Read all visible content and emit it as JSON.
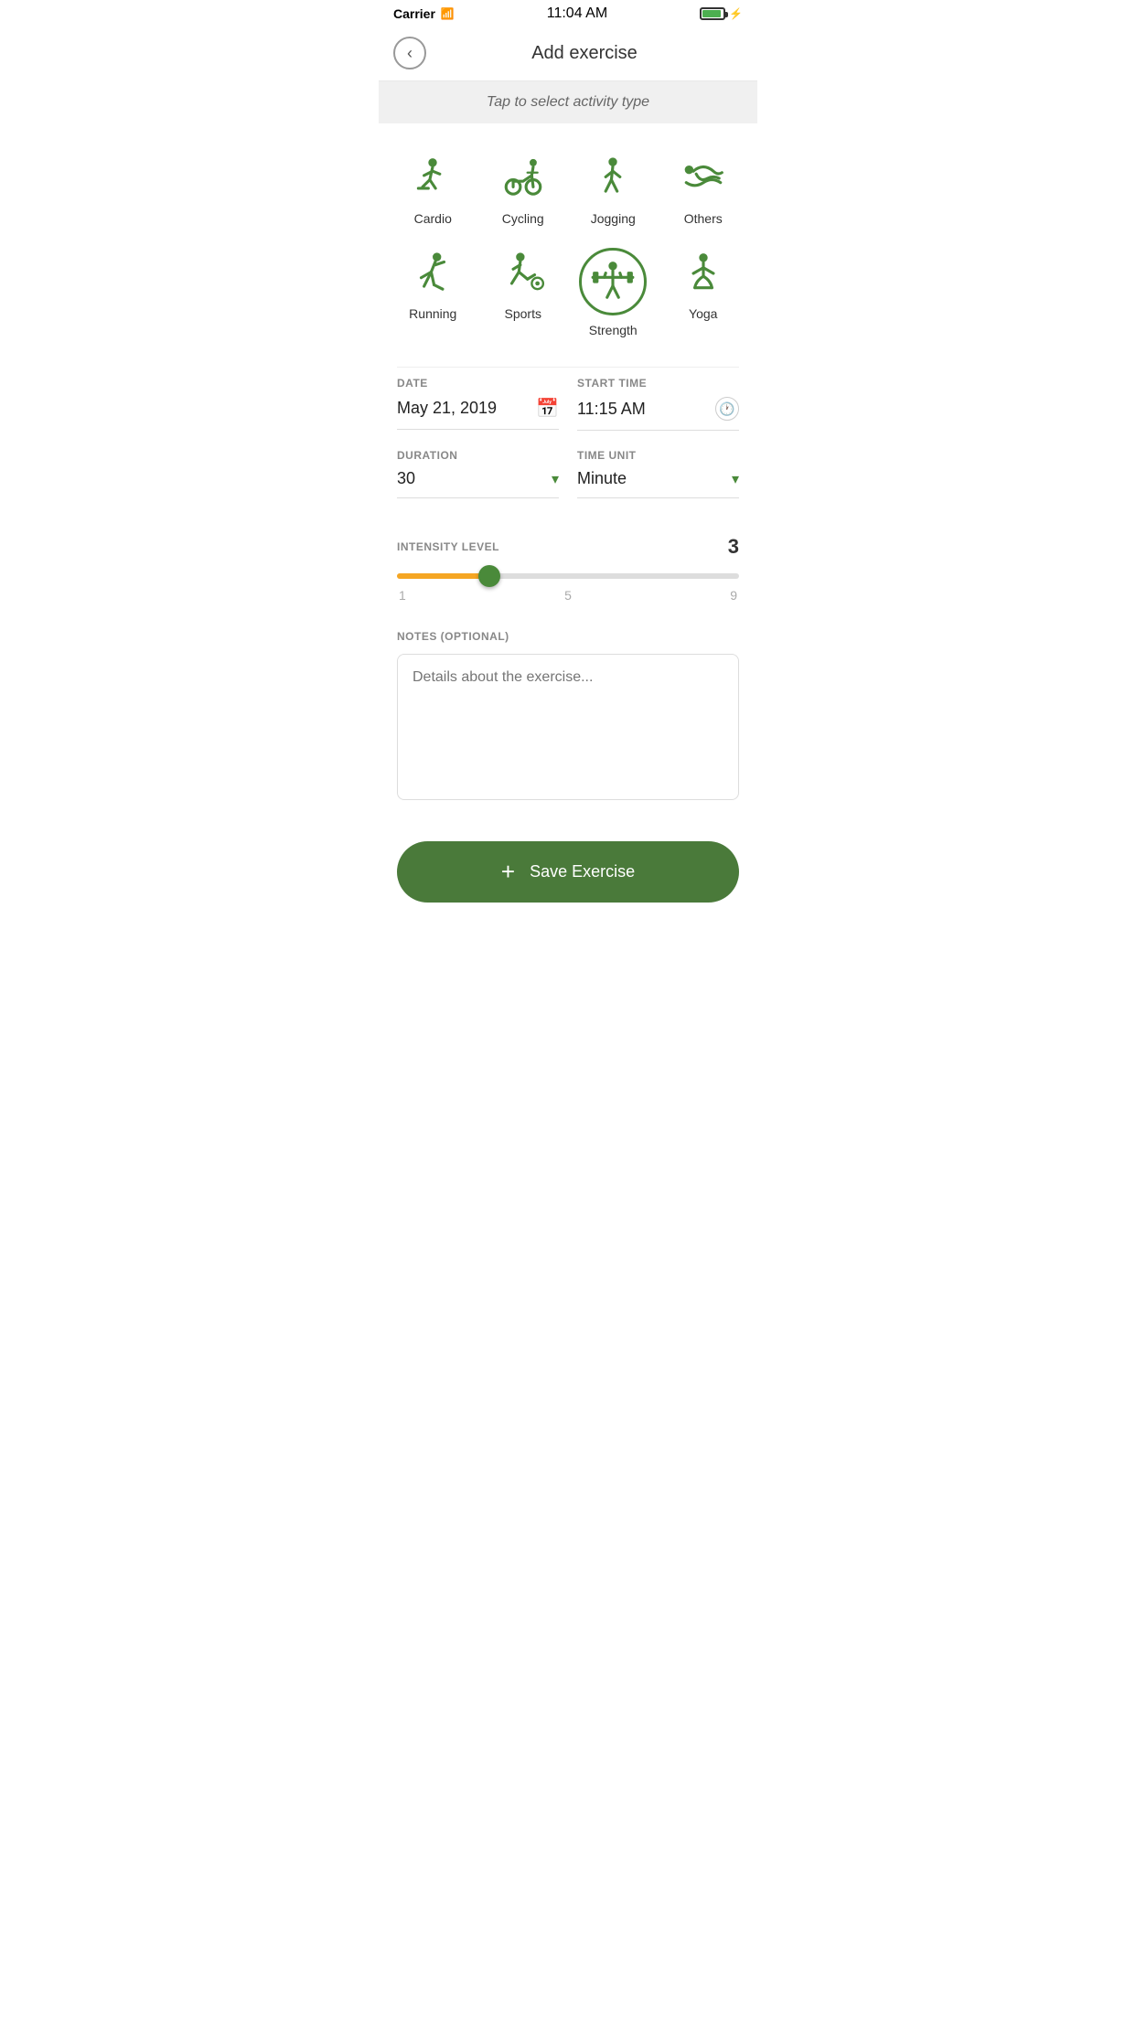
{
  "statusBar": {
    "carrier": "Carrier",
    "time": "11:04 AM"
  },
  "header": {
    "title": "Add exercise",
    "backLabel": "←"
  },
  "banner": {
    "text": "Tap to select activity type"
  },
  "activities": [
    {
      "id": "cardio",
      "label": "Cardio",
      "selected": false
    },
    {
      "id": "cycling",
      "label": "Cycling",
      "selected": false
    },
    {
      "id": "jogging",
      "label": "Jogging",
      "selected": false
    },
    {
      "id": "others",
      "label": "Others",
      "selected": false
    },
    {
      "id": "running",
      "label": "Running",
      "selected": false
    },
    {
      "id": "sports",
      "label": "Sports",
      "selected": false
    },
    {
      "id": "strength",
      "label": "Strength",
      "selected": true
    },
    {
      "id": "yoga",
      "label": "Yoga",
      "selected": false
    }
  ],
  "form": {
    "dateLabel": "DATE",
    "dateValue": "May 21, 2019",
    "startTimeLabel": "START TIME",
    "startTimeValue": "11:15 AM",
    "durationLabel": "DURATION",
    "durationValue": "30",
    "timeUnitLabel": "TIME UNIT",
    "timeUnitValue": "Minute"
  },
  "intensity": {
    "label": "INTENSITY LEVEL",
    "value": "3",
    "min": "1",
    "mid": "5",
    "max": "9",
    "sliderPercent": 27
  },
  "notes": {
    "label": "NOTES (OPTIONAL)",
    "placeholder": "Details about the exercise..."
  },
  "saveButton": {
    "plus": "+",
    "label": "Save Exercise"
  },
  "colors": {
    "green": "#4a8a3a",
    "orange": "#f5a623"
  }
}
